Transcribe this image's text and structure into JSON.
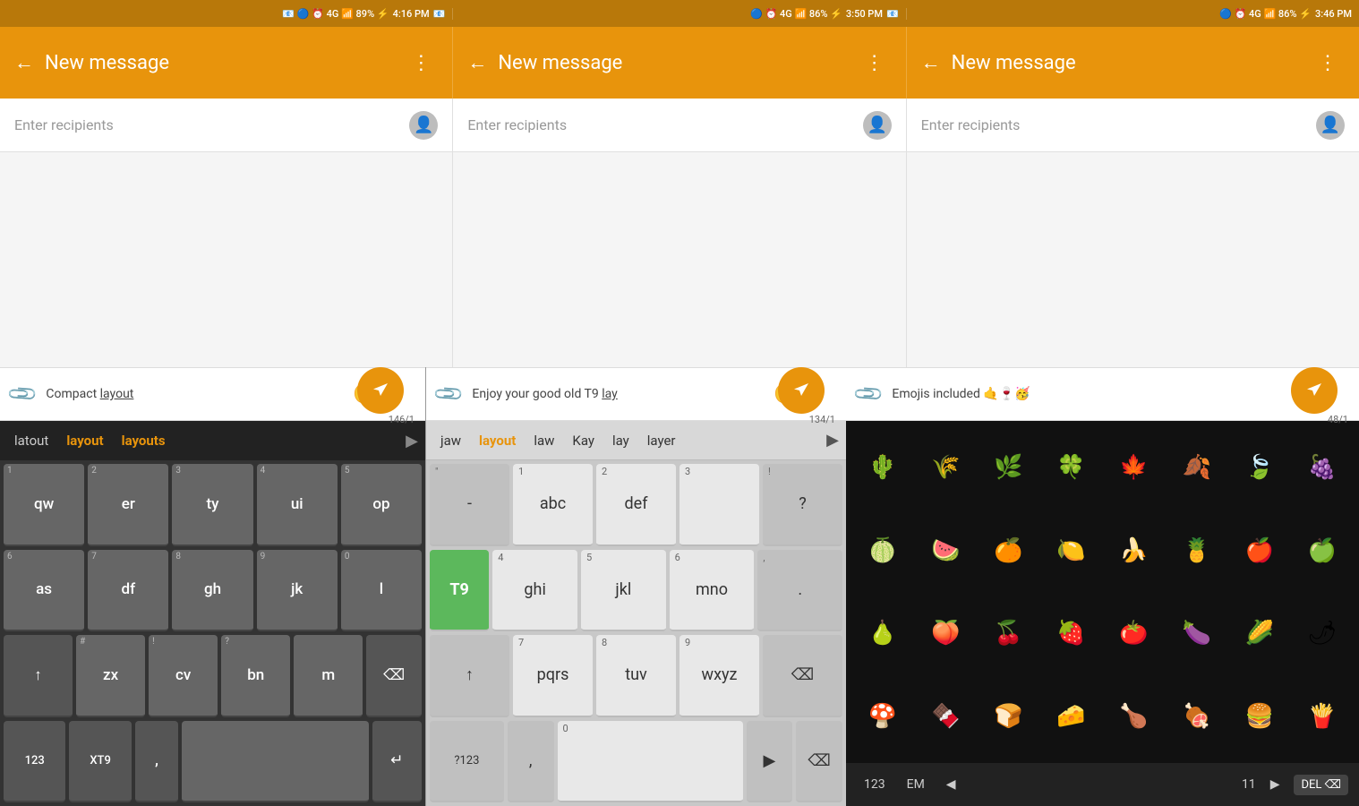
{
  "status_bars": [
    {
      "icons_left": "📧 📋 📁",
      "bluetooth": "⚡",
      "time": "4:16 PM",
      "battery": "89%",
      "signal": "4G"
    },
    {
      "icons_left": "",
      "bluetooth": "⚡",
      "time": "3:50 PM",
      "battery": "86%",
      "signal": "4G"
    },
    {
      "icons_left": "",
      "bluetooth": "⚡",
      "time": "3:46 PM",
      "battery": "86%",
      "signal": "4G"
    }
  ],
  "app_bars": [
    {
      "title": "New message",
      "back": "←",
      "menu": "⋮"
    },
    {
      "title": "New message",
      "back": "←",
      "menu": "⋮"
    },
    {
      "title": "New message",
      "back": "←",
      "menu": "⋮"
    }
  ],
  "recipients": [
    {
      "placeholder": "Enter recipients"
    },
    {
      "placeholder": "Enter recipients"
    },
    {
      "placeholder": "Enter recipients"
    }
  ],
  "toolbars": [
    {
      "text": "Compact ",
      "underline": "layout",
      "count": ""
    },
    {
      "text": "Enjoy your good old T9 ",
      "underline": "lay",
      "count": "134/1"
    },
    {
      "text": "Emojis included 🤙🍷🥳",
      "underline": "",
      "count": "48/1"
    }
  ],
  "toolbar1_count": "146/1",
  "suggestions": [
    "latout",
    "layout",
    "layouts"
  ],
  "t9_suggestions": [
    "jaw",
    "layout",
    "law",
    "Kay",
    "lay",
    "layer"
  ],
  "compact_keys": {
    "row1": [
      {
        "num": "1",
        "label": "qw"
      },
      {
        "num": "2",
        "label": "er"
      },
      {
        "num": "3",
        "label": "ty"
      },
      {
        "num": "4",
        "label": "ui"
      },
      {
        "num": "5",
        "label": "op"
      }
    ],
    "row2": [
      {
        "num": "6",
        "label": "as"
      },
      {
        "num": "7",
        "label": "df"
      },
      {
        "num": "8",
        "label": "gh"
      },
      {
        "num": "9",
        "label": "jk"
      },
      {
        "num": "0",
        "label": "l"
      }
    ],
    "row3_special": [
      {
        "label": "↑",
        "type": "shift"
      },
      {
        "num": "#",
        "label": "zx"
      },
      {
        "num": "!",
        "label": "cv"
      },
      {
        "num": "?",
        "label": "bn"
      },
      {
        "label": "m"
      },
      {
        "label": "⌫",
        "type": "backspace"
      }
    ],
    "row4_special": [
      {
        "label": "123",
        "type": "num123"
      },
      {
        "label": "XT9",
        "type": "xt9"
      },
      {
        "label": ",",
        "type": "comma"
      },
      {
        "label": "     ",
        "type": "space"
      },
      {
        "label": "↵",
        "type": "enter"
      }
    ]
  },
  "t9_keys": {
    "row1": [
      {
        "label": "-",
        "sub": "\"",
        "num": "1"
      },
      {
        "label": "abc",
        "num": "2"
      },
      {
        "label": "def",
        "num": "3"
      },
      {
        "label": "?",
        "sub": "!",
        "type": "special"
      }
    ],
    "row2": [
      {
        "label": "T9",
        "type": "t9-active"
      },
      {
        "label": "ghi",
        "num": "4"
      },
      {
        "label": "jkl",
        "num": "5"
      },
      {
        "label": "mno",
        "num": "6"
      },
      {
        "label": ".",
        "sub": ",",
        "type": "special"
      }
    ],
    "row3": [
      {
        "label": "↑",
        "type": "special"
      },
      {
        "label": "pqrs",
        "num": "7"
      },
      {
        "label": "tuv",
        "num": "8"
      },
      {
        "label": "wxyz",
        "num": "9"
      },
      {
        "label": "⌫",
        "type": "special"
      }
    ],
    "row4": [
      {
        "label": "?123",
        "type": "special"
      },
      {
        "label": ",",
        "num": ""
      },
      {
        "label": "     ",
        "num": "0"
      },
      {
        "label": "▶",
        "type": "special"
      },
      {
        "label": "⌫",
        "type": "special"
      }
    ]
  },
  "emojis": [
    "🌵",
    "🌾",
    "🌿",
    "🍀",
    "🍁",
    "🍂",
    "🍃",
    "🍇",
    "🍈",
    "🍉",
    "🍊",
    "🍋",
    "🍌",
    "🍍",
    "🍎",
    "🍏",
    "🍐",
    "🍑",
    "🍒",
    "🍓",
    "🍅",
    "🍆",
    "🌽",
    "🌶",
    "🍄",
    "🍫",
    "🍞",
    "🧀",
    "🍗",
    "🍖",
    "🍔",
    "🍟"
  ],
  "emoji_bar": {
    "btn1": "123",
    "btn2": "EM",
    "prev": "◀",
    "num": "11",
    "next": "▶",
    "del": "DEL ⌫"
  }
}
